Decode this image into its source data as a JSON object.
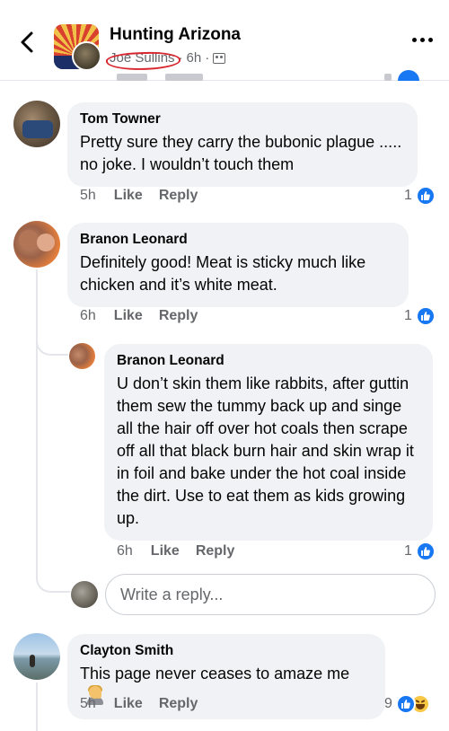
{
  "header": {
    "group_name": "Hunting Arizona",
    "author": "Joe Sullins",
    "separator1": "·",
    "time": "6h",
    "separator2": "·",
    "icons": {
      "back": "chevron-left-icon",
      "more": "more-dots-icon",
      "audience": "group-audience-icon"
    }
  },
  "comments": [
    {
      "name": "Tom Towner",
      "text": "Pretty sure they carry the bubonic plague ..... no joke. I wouldn’t touch them",
      "time": "5h",
      "like_label": "Like",
      "reply_label": "Reply",
      "reaction_count": "1"
    },
    {
      "name": "Branon Leonard",
      "text": "Definitely good! Meat is sticky much like chicken and it’s white meat.",
      "time": "6h",
      "like_label": "Like",
      "reply_label": "Reply",
      "reaction_count": "1"
    },
    {
      "name": "Branon Leonard",
      "text": "U don’t skin them like rabbits, after guttin them sew the tummy back up and singe all the hair off over hot coals then scrape off all that black burn hair and skin wrap it in foil and bake under the hot coal inside the dirt. Use to eat them as kids growing up.",
      "time": "6h",
      "like_label": "Like",
      "reply_label": "Reply",
      "reaction_count": "1"
    },
    {
      "name": "Clayton Smith",
      "text": "This page never ceases to amaze me",
      "time": "5h",
      "like_label": "Like",
      "reply_label": "Reply",
      "reaction_count": "9"
    }
  ],
  "reply_input": {
    "placeholder": "Write a reply..."
  },
  "colors": {
    "like_blue": "#1877f2",
    "bubble_bg": "#f0f2f5",
    "meta_gray": "#65676b",
    "redaction_red": "#d8262f"
  }
}
